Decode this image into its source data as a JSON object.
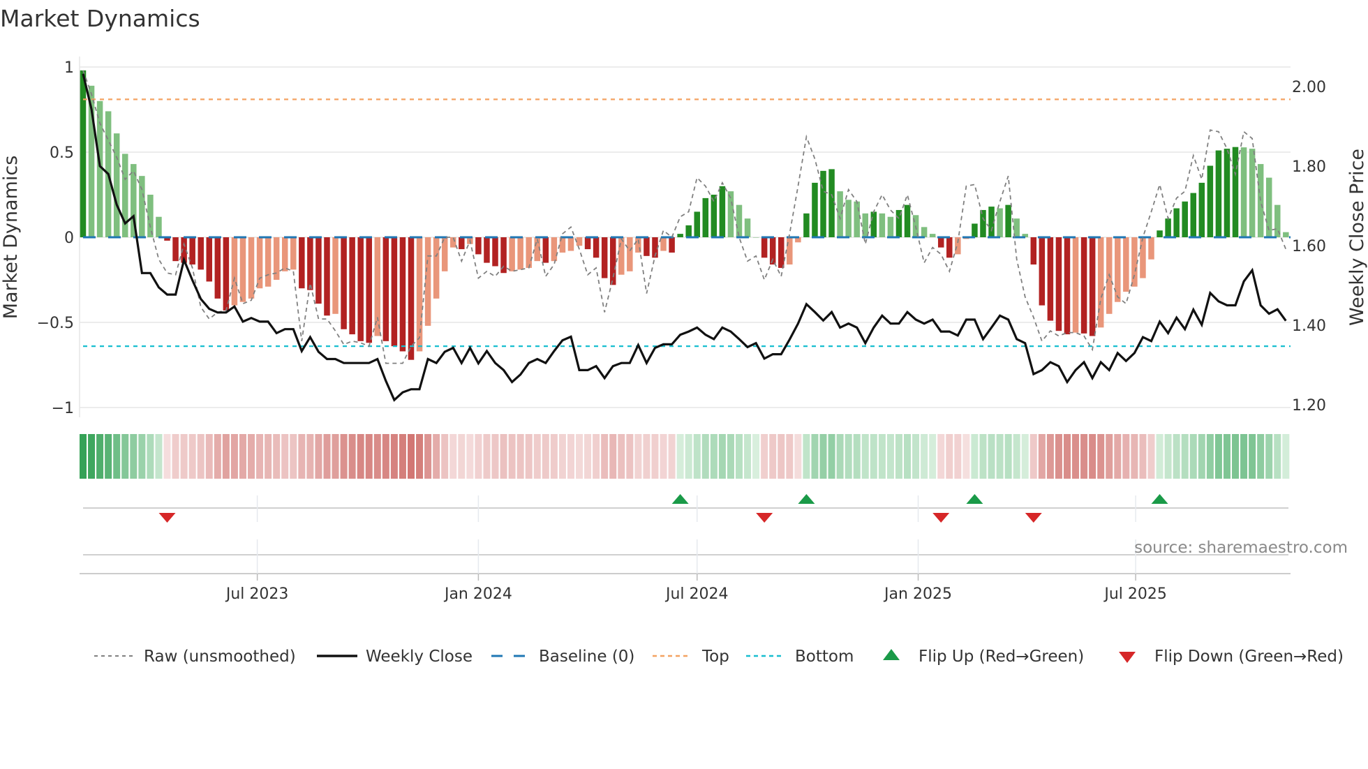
{
  "title": "Market Dynamics",
  "source": "source: sharemaestro.com",
  "colors": {
    "bar_up_rising": "#228b22",
    "bar_up_falling": "#7fbf7f",
    "bar_down_falling": "#b22222",
    "bar_down_rising": "#e9967a",
    "raw": "#808080",
    "close": "#111111",
    "baseline": "#1f77b4",
    "top": "#f4a261",
    "bottom": "#17becf",
    "flip_up": "#1a9a48",
    "flip_down": "#d62728",
    "strip_green": "#35a257",
    "strip_red": "#d0736f"
  },
  "legend": [
    {
      "key": "raw",
      "label": "Raw (unsmoothed)"
    },
    {
      "key": "close",
      "label": "Weekly Close"
    },
    {
      "key": "baseline",
      "label": "Baseline (0)"
    },
    {
      "key": "top",
      "label": "Top"
    },
    {
      "key": "bottom",
      "label": "Bottom"
    },
    {
      "key": "flip_up",
      "label": "Flip Up (Red→Green)"
    },
    {
      "key": "flip_down",
      "label": "Flip Down (Green→Red)"
    }
  ],
  "chart_data": {
    "type": "bar",
    "title": "Market Dynamics",
    "grid": true,
    "legend_position": "bottom",
    "x_axis": {
      "type": "date",
      "ticks": [
        {
          "label": "Jul 2023",
          "date": "2023-07-01"
        },
        {
          "label": "Jan 2024",
          "date": "2024-01-01"
        },
        {
          "label": "Jul 2024",
          "date": "2024-07-01"
        },
        {
          "label": "Jan 2025",
          "date": "2025-01-01"
        },
        {
          "label": "Jul 2025",
          "date": "2025-07-01"
        }
      ]
    },
    "y_left": {
      "label": "Market Dynamics",
      "range": [
        -1,
        1
      ],
      "ticks": [
        {
          "v": 1,
          "label": "1"
        },
        {
          "v": 0.5,
          "label": "0.5"
        },
        {
          "v": 0,
          "label": "0"
        },
        {
          "v": -0.5,
          "label": "−0.5"
        },
        {
          "v": -1,
          "label": "−1"
        }
      ]
    },
    "y_right": {
      "label": "Weekly Close Price",
      "range": [
        1.2,
        2.0
      ],
      "ticks": [
        {
          "v": 2.0,
          "label": "2.00"
        },
        {
          "v": 1.8,
          "label": "1.80"
        },
        {
          "v": 1.6,
          "label": "1.60"
        },
        {
          "v": 1.4,
          "label": "1.40"
        },
        {
          "v": 1.2,
          "label": "1.20"
        }
      ]
    },
    "reference_lines": {
      "baseline": 0,
      "top": 0.81,
      "bottom": -0.64
    },
    "dates": [
      "2023-02-06",
      "2023-02-13",
      "2023-02-20",
      "2023-02-27",
      "2023-03-06",
      "2023-03-13",
      "2023-03-20",
      "2023-03-27",
      "2023-04-03",
      "2023-04-10",
      "2023-04-17",
      "2023-04-24",
      "2023-05-01",
      "2023-05-08",
      "2023-05-15",
      "2023-05-22",
      "2023-05-29",
      "2023-06-05",
      "2023-06-12",
      "2023-06-19",
      "2023-06-26",
      "2023-07-03",
      "2023-07-10",
      "2023-07-17",
      "2023-07-24",
      "2023-07-31",
      "2023-08-07",
      "2023-08-14",
      "2023-08-21",
      "2023-08-28",
      "2023-09-04",
      "2023-09-11",
      "2023-09-18",
      "2023-09-25",
      "2023-10-02",
      "2023-10-09",
      "2023-10-16",
      "2023-10-23",
      "2023-10-30",
      "2023-11-06",
      "2023-11-13",
      "2023-11-20",
      "2023-11-27",
      "2023-12-04",
      "2023-12-11",
      "2023-12-18",
      "2023-12-25",
      "2024-01-01",
      "2024-01-08",
      "2024-01-15",
      "2024-01-22",
      "2024-01-29",
      "2024-02-05",
      "2024-02-12",
      "2024-02-19",
      "2024-02-26",
      "2024-03-04",
      "2024-03-11",
      "2024-03-18",
      "2024-03-25",
      "2024-04-01",
      "2024-04-08",
      "2024-04-15",
      "2024-04-22",
      "2024-04-29",
      "2024-05-06",
      "2024-05-13",
      "2024-05-20",
      "2024-05-27",
      "2024-06-03",
      "2024-06-10",
      "2024-06-17",
      "2024-06-24",
      "2024-07-01",
      "2024-07-08",
      "2024-07-15",
      "2024-07-22",
      "2024-07-29",
      "2024-08-05",
      "2024-08-12",
      "2024-08-19",
      "2024-08-26",
      "2024-09-02",
      "2024-09-09",
      "2024-09-16",
      "2024-09-23",
      "2024-09-30",
      "2024-10-07",
      "2024-10-14",
      "2024-10-21",
      "2024-10-28",
      "2024-11-04",
      "2024-11-11",
      "2024-11-18",
      "2024-11-25",
      "2024-12-02",
      "2024-12-09",
      "2024-12-16",
      "2024-12-23",
      "2024-12-30",
      "2025-01-06",
      "2025-01-13",
      "2025-01-20",
      "2025-01-27",
      "2025-02-03",
      "2025-02-10",
      "2025-02-17",
      "2025-02-24",
      "2025-03-03",
      "2025-03-10",
      "2025-03-17",
      "2025-03-24",
      "2025-03-31",
      "2025-04-07",
      "2025-04-14",
      "2025-04-21",
      "2025-04-28",
      "2025-05-05",
      "2025-05-12",
      "2025-05-19",
      "2025-05-26",
      "2025-06-02",
      "2025-06-09",
      "2025-06-16",
      "2025-06-23",
      "2025-06-30",
      "2025-07-07",
      "2025-07-14",
      "2025-07-21",
      "2025-07-28",
      "2025-08-04",
      "2025-08-11",
      "2025-08-18",
      "2025-08-25",
      "2025-09-01",
      "2025-09-08",
      "2025-09-15",
      "2025-09-22",
      "2025-09-29",
      "2025-10-06",
      "2025-10-13",
      "2025-10-20",
      "2025-10-27",
      "2025-11-03"
    ],
    "bars": {
      "axis": "left",
      "values": [
        0.98,
        0.89,
        0.8,
        0.74,
        0.61,
        0.49,
        0.43,
        0.36,
        0.25,
        0.12,
        -0.02,
        -0.14,
        -0.15,
        -0.16,
        -0.19,
        -0.26,
        -0.36,
        -0.43,
        -0.4,
        -0.38,
        -0.36,
        -0.3,
        -0.29,
        -0.25,
        -0.2,
        -0.19,
        -0.3,
        -0.31,
        -0.39,
        -0.46,
        -0.45,
        -0.54,
        -0.57,
        -0.61,
        -0.62,
        -0.58,
        -0.61,
        -0.64,
        -0.67,
        -0.72,
        -0.67,
        -0.52,
        -0.36,
        -0.2,
        -0.06,
        -0.07,
        -0.04,
        -0.1,
        -0.15,
        -0.17,
        -0.21,
        -0.2,
        -0.19,
        -0.18,
        -0.14,
        -0.15,
        -0.14,
        -0.09,
        -0.08,
        -0.05,
        -0.07,
        -0.12,
        -0.24,
        -0.28,
        -0.22,
        -0.2,
        -0.09,
        -0.11,
        -0.12,
        -0.08,
        -0.09,
        0.02,
        0.07,
        0.15,
        0.23,
        0.25,
        0.3,
        0.27,
        0.19,
        0.11,
        0.0,
        -0.12,
        -0.16,
        -0.18,
        -0.16,
        -0.03,
        0.14,
        0.32,
        0.39,
        0.4,
        0.27,
        0.22,
        0.21,
        0.14,
        0.15,
        0.14,
        0.12,
        0.16,
        0.19,
        0.13,
        0.06,
        0.02,
        -0.06,
        -0.12,
        -0.1,
        -0.01,
        0.08,
        0.16,
        0.18,
        0.17,
        0.19,
        0.11,
        0.02,
        -0.16,
        -0.4,
        -0.49,
        -0.55,
        -0.57,
        -0.56,
        -0.565,
        -0.58,
        -0.53,
        -0.45,
        -0.38,
        -0.32,
        -0.29,
        -0.24,
        -0.13,
        0.04,
        0.11,
        0.17,
        0.21,
        0.26,
        0.32,
        0.42,
        0.51,
        0.52,
        0.53,
        0.528,
        0.52,
        0.43,
        0.35,
        0.19,
        0.03
      ]
    },
    "series": [
      {
        "name": "Raw (unsmoothed)",
        "axis": "left",
        "values": [
          0.98,
          0.84,
          0.67,
          0.57,
          0.47,
          0.34,
          0.39,
          0.28,
          0.06,
          -0.13,
          -0.21,
          -0.22,
          -0.04,
          -0.18,
          -0.41,
          -0.48,
          -0.44,
          -0.43,
          -0.24,
          -0.39,
          -0.37,
          -0.24,
          -0.22,
          -0.21,
          -0.18,
          -0.2,
          -0.61,
          -0.27,
          -0.48,
          -0.48,
          -0.55,
          -0.63,
          -0.61,
          -0.62,
          -0.64,
          -0.47,
          -0.74,
          -0.74,
          -0.74,
          -0.64,
          -0.59,
          -0.11,
          -0.11,
          0.0,
          0.0,
          -0.14,
          -0.02,
          -0.24,
          -0.2,
          -0.23,
          -0.17,
          -0.2,
          -0.19,
          -0.18,
          -0.01,
          -0.23,
          -0.16,
          0.02,
          0.06,
          -0.07,
          -0.22,
          -0.18,
          -0.44,
          -0.24,
          -0.01,
          -0.08,
          -0.01,
          -0.33,
          -0.11,
          0.04,
          0.0,
          0.12,
          0.15,
          0.35,
          0.3,
          0.21,
          0.32,
          0.23,
          0.0,
          -0.14,
          -0.11,
          -0.25,
          -0.13,
          -0.23,
          0.02,
          0.3,
          0.59,
          0.46,
          0.27,
          0.25,
          0.11,
          0.28,
          0.21,
          -0.04,
          0.15,
          0.25,
          0.16,
          0.11,
          0.25,
          0.06,
          -0.15,
          -0.06,
          -0.1,
          -0.2,
          -0.03,
          0.3,
          0.31,
          0.11,
          0.04,
          0.21,
          0.36,
          -0.13,
          -0.35,
          -0.47,
          -0.61,
          -0.55,
          -0.58,
          -0.56,
          -0.56,
          -0.58,
          -0.66,
          -0.36,
          -0.22,
          -0.35,
          -0.39,
          -0.22,
          0.0,
          0.15,
          0.31,
          0.11,
          0.23,
          0.27,
          0.48,
          0.34,
          0.63,
          0.62,
          0.52,
          0.37,
          0.62,
          0.58,
          0.21,
          0.04,
          0.05,
          -0.07
        ]
      },
      {
        "name": "Weekly Close",
        "axis": "right",
        "values": [
          2.032,
          1.943,
          1.8,
          1.78,
          1.703,
          1.656,
          1.674,
          1.531,
          1.531,
          1.495,
          1.477,
          1.477,
          1.564,
          1.513,
          1.466,
          1.441,
          1.432,
          1.432,
          1.447,
          1.409,
          1.418,
          1.409,
          1.409,
          1.38,
          1.39,
          1.39,
          1.335,
          1.37,
          1.333,
          1.315,
          1.315,
          1.305,
          1.305,
          1.305,
          1.305,
          1.315,
          1.26,
          1.212,
          1.231,
          1.239,
          1.239,
          1.315,
          1.305,
          1.333,
          1.343,
          1.305,
          1.343,
          1.304,
          1.335,
          1.305,
          1.287,
          1.257,
          1.276,
          1.305,
          1.315,
          1.305,
          1.335,
          1.362,
          1.371,
          1.287,
          1.287,
          1.297,
          1.267,
          1.297,
          1.305,
          1.305,
          1.35,
          1.305,
          1.343,
          1.352,
          1.352,
          1.376,
          1.384,
          1.394,
          1.376,
          1.365,
          1.394,
          1.384,
          1.365,
          1.345,
          1.355,
          1.316,
          1.327,
          1.327,
          1.364,
          1.404,
          1.453,
          1.433,
          1.412,
          1.433,
          1.394,
          1.404,
          1.394,
          1.355,
          1.394,
          1.424,
          1.404,
          1.404,
          1.433,
          1.414,
          1.404,
          1.414,
          1.384,
          1.384,
          1.374,
          1.414,
          1.414,
          1.365,
          1.394,
          1.424,
          1.414,
          1.365,
          1.355,
          1.277,
          1.287,
          1.307,
          1.297,
          1.257,
          1.287,
          1.307,
          1.267,
          1.307,
          1.287,
          1.33,
          1.31,
          1.33,
          1.37,
          1.36,
          1.409,
          1.38,
          1.419,
          1.39,
          1.439,
          1.401,
          1.481,
          1.46,
          1.45,
          1.45,
          1.51,
          1.538,
          1.45,
          1.429,
          1.44,
          1.411
        ]
      }
    ],
    "flip_up_dates": [
      "2024-06-17",
      "2024-09-30",
      "2025-02-17",
      "2025-07-21"
    ],
    "flip_down_dates": [
      "2023-04-17",
      "2024-08-26",
      "2025-01-20",
      "2025-04-07"
    ]
  }
}
